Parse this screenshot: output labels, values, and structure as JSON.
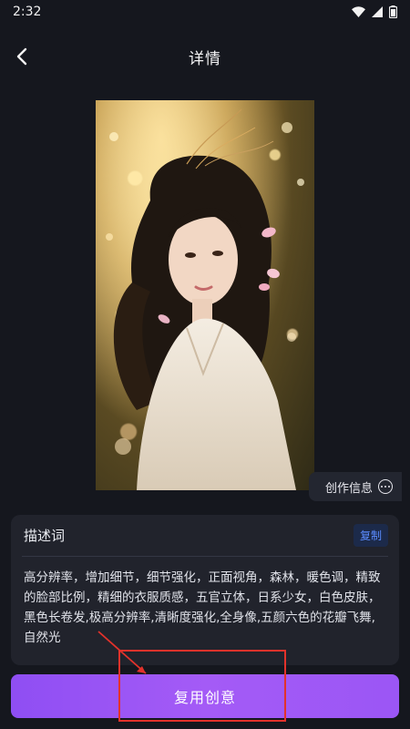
{
  "status_bar": {
    "time": "2:32",
    "icons": [
      "wifi-icon",
      "signal-icon",
      "battery-icon"
    ]
  },
  "nav": {
    "back_icon": "chevron-left-icon",
    "title": "详情"
  },
  "artwork": {
    "subject": "ai-generated-portrait-image"
  },
  "create_info": {
    "label": "创作信息",
    "icon": "more-dots-icon"
  },
  "description": {
    "title": "描述词",
    "copy_label": "复制",
    "text": "高分辨率，增加细节，细节强化，正面视角，森林，暖色调，精致的脸部比例，精细的衣服质感，五官立体，日系少女，白色皮肤，黑色长卷发,极高分辨率,清晰度强化,全身像,五颜六色的花瓣飞舞,自然光"
  },
  "primary_action": {
    "label": "复用创意"
  },
  "colors": {
    "background": "#15171e",
    "card": "#21232c",
    "accent": "#9b56f5",
    "copy_text": "#5b8cff",
    "annotation": "#e3322b"
  }
}
